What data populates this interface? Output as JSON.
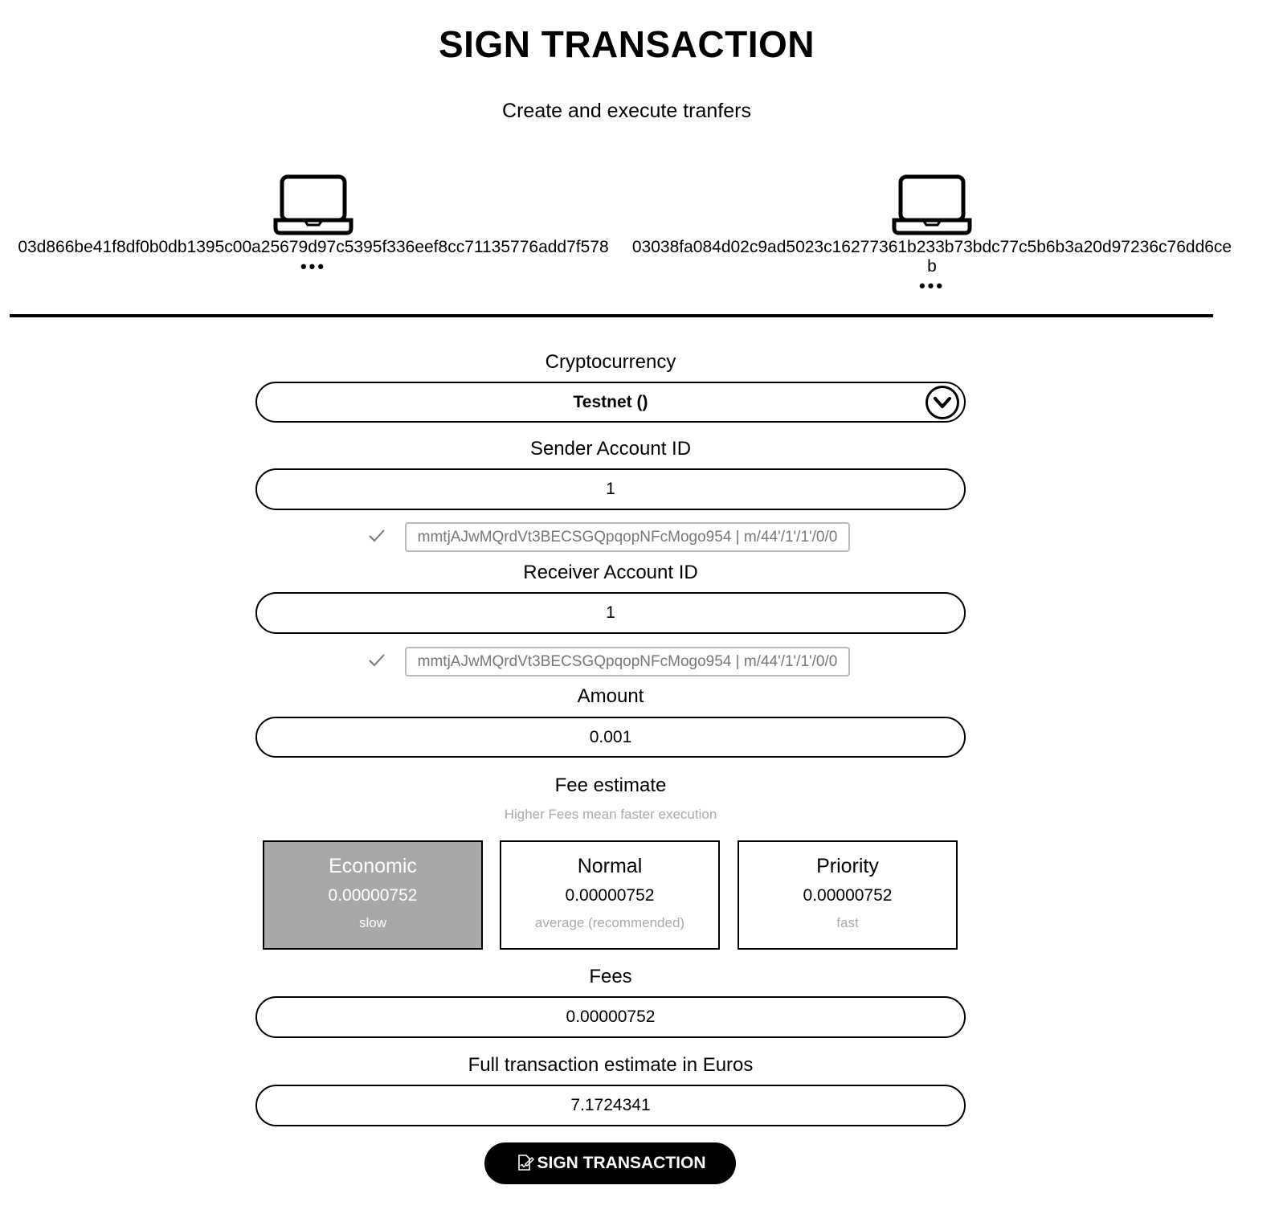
{
  "header": {
    "title": "SIGN TRANSACTION",
    "subtitle": "Create and execute tranfers"
  },
  "devices": [
    {
      "icon": "laptop-icon",
      "pubkey": "03d866be41f8df0b0db1395c00a25679d97c5395f336eef8cc71135776add7f578",
      "menu": "•••"
    },
    {
      "icon": "laptop-icon",
      "pubkey": "03038fa084d02c9ad5023c16277361b233b73bdc77c5b6b3a20d97236c76dd6ceb",
      "menu": "•••"
    }
  ],
  "form": {
    "cryptocurrency": {
      "label": "Cryptocurrency",
      "value": "Testnet ()",
      "icon": "chevron-down-circle-icon"
    },
    "sender": {
      "label": "Sender Account ID",
      "value": "1",
      "address": "mmtjAJwMQrdVt3BECSGQpqopNFcMogo954 | m/44'/1'/1'/0/0",
      "status_icon": "check-icon"
    },
    "receiver": {
      "label": "Receiver Account ID",
      "value": "1",
      "address": "mmtjAJwMQrdVt3BECSGQpqopNFcMogo954 | m/44'/1'/1'/0/0",
      "status_icon": "check-icon"
    },
    "amount": {
      "label": "Amount",
      "value": "0.001"
    },
    "fee_estimate": {
      "label": "Fee estimate",
      "hint": "Higher Fees mean faster execution",
      "options": [
        {
          "name": "Economic",
          "value": "0.00000752",
          "speed": "slow",
          "selected": true
        },
        {
          "name": "Normal",
          "value": "0.00000752",
          "speed": "average (recommended)",
          "selected": false
        },
        {
          "name": "Priority",
          "value": "0.00000752",
          "speed": "fast",
          "selected": false
        }
      ]
    },
    "fees": {
      "label": "Fees",
      "value": "0.00000752"
    },
    "total_euros": {
      "label": "Full transaction estimate in Euros",
      "value": "7.1724341"
    }
  },
  "actions": {
    "sign_label": "SIGN TRANSACTION",
    "sign_icon": "sign-document-icon"
  },
  "colors": {
    "selected_card_bg": "#a8a8a8",
    "hint_text": "#aaaaaa",
    "button_bg": "#000000"
  }
}
